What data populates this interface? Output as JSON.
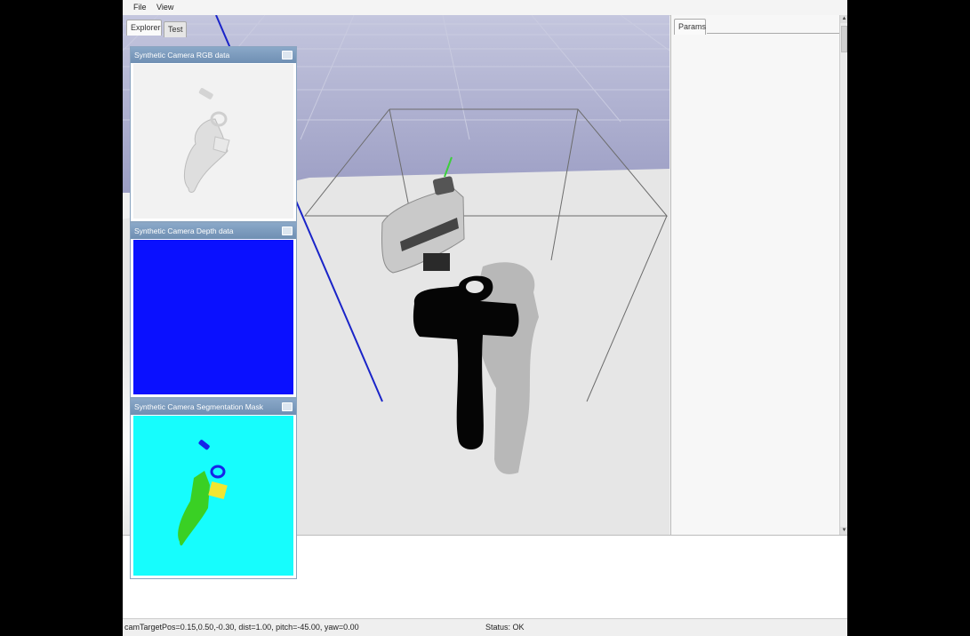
{
  "menu": {
    "file": "File",
    "view": "View"
  },
  "left_tabs": [
    {
      "label": "Explorer"
    },
    {
      "label": "Test"
    }
  ],
  "right_tab": {
    "label": "Params"
  },
  "panels": {
    "rgb": {
      "title": "Synthetic Camera RGB data"
    },
    "depth": {
      "title": "Synthetic Camera Depth data"
    },
    "seg": {
      "title": "Synthetic Camera Segmentation Mask"
    }
  },
  "status": {
    "camera": "camTargetPos=0.15,0.50,-0.30, dist=1.00, pitch=-45.00, yaw=0.00",
    "state": "Status: OK"
  },
  "colors": {
    "sky": "#a4a6c6",
    "floor": "#e4e4e4",
    "depth_blue": "#0a10ff",
    "seg_cyan": "#16fdfd",
    "seg_green": "#3ad024",
    "seg_yellow": "#f2e630",
    "seg_blue": "#1624e8"
  }
}
